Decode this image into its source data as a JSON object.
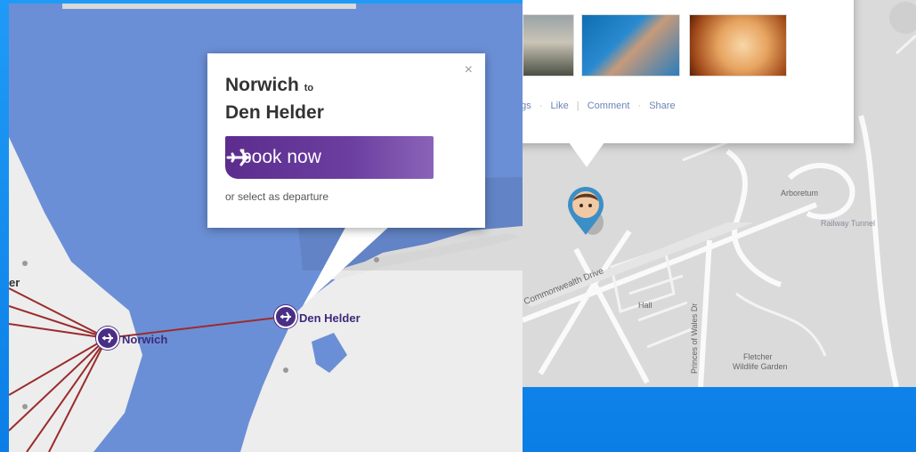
{
  "colors": {
    "accent": "#5c2d8e",
    "sea": "#6b8fd6",
    "route": "#9b2c2c",
    "frame": "#1a8ff0"
  },
  "left": {
    "popup": {
      "close_label": "×",
      "title_from": "Norwich",
      "title_to_word": "to",
      "title_to": "Den Helder",
      "book_label": "book now",
      "book_icon": "airplane-icon",
      "sub_label": "or select as departure"
    },
    "places": {
      "norwich": "Norwich",
      "den_helder": "Den Helder",
      "partial": "er"
    }
  },
  "right": {
    "actions": [
      "ags",
      "Like",
      "Comment",
      "Share"
    ],
    "labels": {
      "arboretum": "Arboretum",
      "road": "Commonwealth Drive",
      "hall": "Hall",
      "princes": "Princes of Wales Dr",
      "garden1": "Fletcher",
      "garden2": "Wildlife Garden",
      "railway": "Railway Tunnel"
    }
  }
}
